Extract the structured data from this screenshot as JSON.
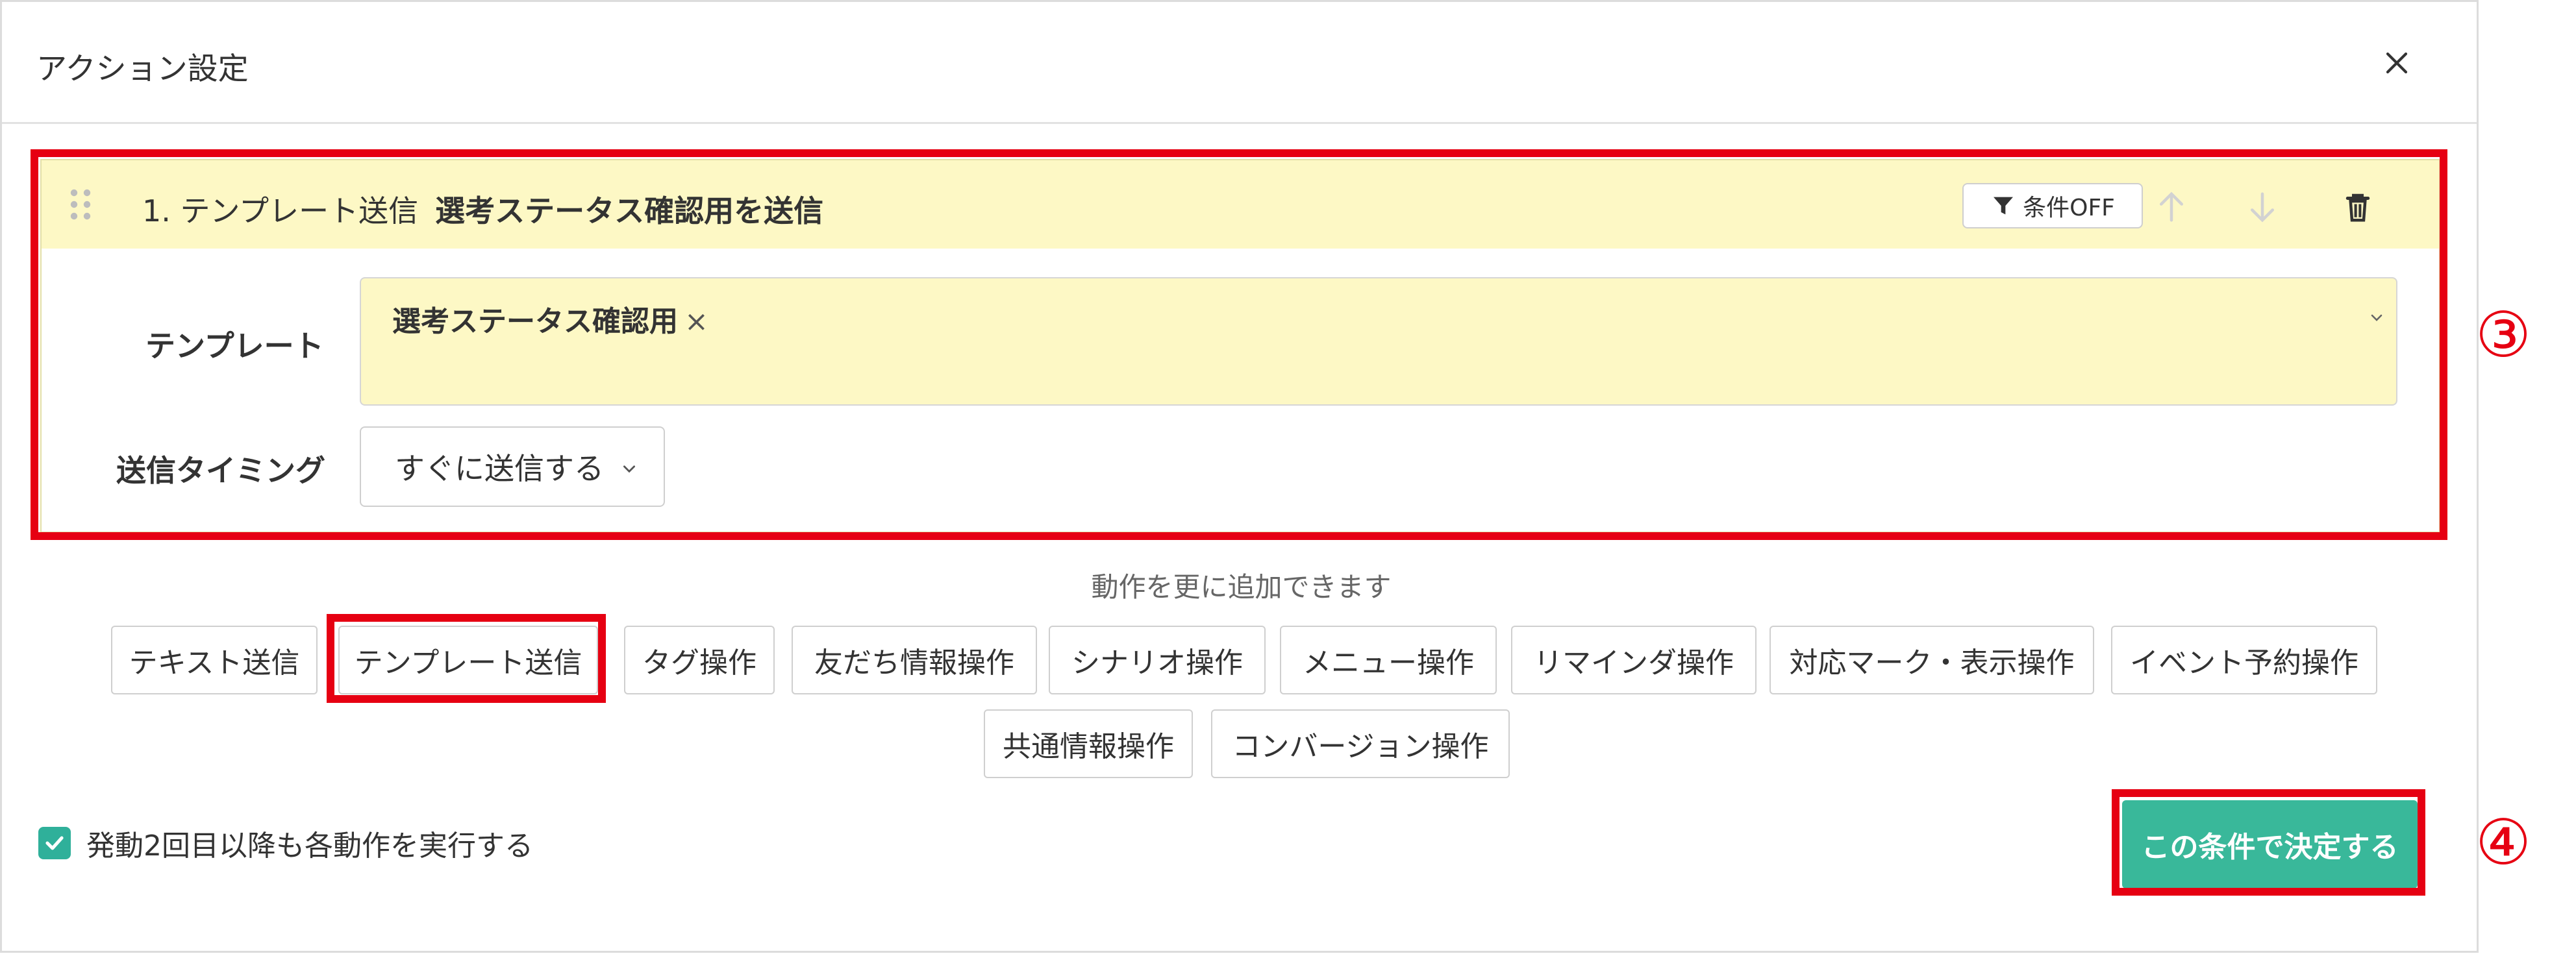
{
  "modal": {
    "title": "アクション設定"
  },
  "action": {
    "index_type": "1. テンプレート送信",
    "name": "選考ステータス確認用を送信",
    "condition_label": "条件OFF"
  },
  "form": {
    "template_label": "テンプレート",
    "template_tag": "選考ステータス確認用",
    "tag_remove": "×",
    "timing_label": "送信タイミング",
    "timing_value": "すぐに送信する"
  },
  "add_hint": "動作を更に追加できます",
  "operations": [
    "テキスト送信",
    "テンプレート送信",
    "タグ操作",
    "友だち情報操作",
    "シナリオ操作",
    "メニュー操作",
    "リマインダ操作",
    "対応マーク・表示操作",
    "イベント予約操作",
    "共通情報操作",
    "コンバージョン操作"
  ],
  "footer": {
    "repeat_label": "発動2回目以降も各動作を実行する",
    "repeat_checked": true,
    "submit_label": "この条件で決定する"
  },
  "annotations": {
    "marker_3": "③",
    "marker_4": "④",
    "color": "#e60012"
  },
  "colors": {
    "accent": "#39b89a",
    "card_header": "#fdf8c5",
    "checkbox": "#2fb09a"
  }
}
